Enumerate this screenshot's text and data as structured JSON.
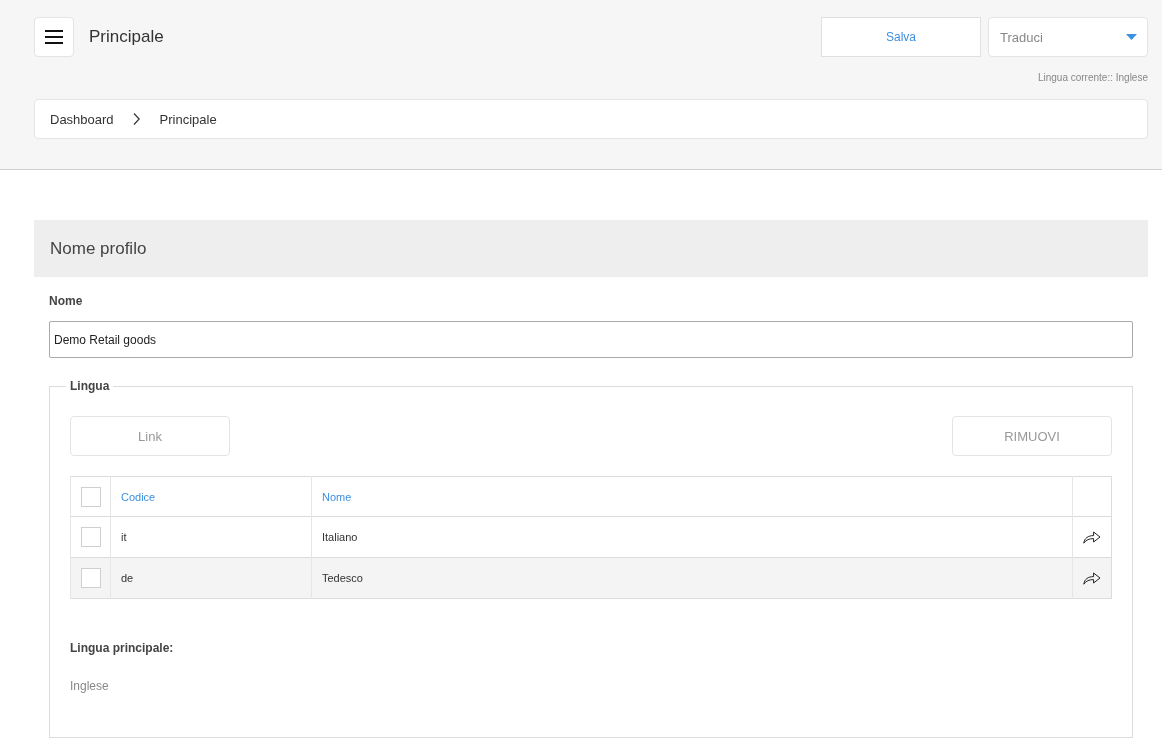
{
  "header": {
    "title": "Principale",
    "save_button": "Salva",
    "translate_select": {
      "value": "Traduci"
    },
    "current_language": "Lingua corrente:: Inglese"
  },
  "breadcrumb": [
    {
      "label": "Dashboard"
    },
    {
      "label": "Principale"
    }
  ],
  "section": {
    "title": "Nome profilo"
  },
  "name_field": {
    "label": "Nome",
    "value": "Demo Retail goods"
  },
  "language_group": {
    "legend": "Lingua",
    "buttons": [
      {
        "label": "Link",
        "disabled": true
      },
      {
        "label": "RIMUOVI",
        "disabled": true
      }
    ],
    "table": {
      "select_all_checked": false,
      "columns": [
        "Codice",
        "Nome"
      ],
      "rows": [
        {
          "code": "it",
          "name": "Italiano",
          "checked": false
        },
        {
          "code": "de",
          "name": "Tedesco",
          "checked": false
        }
      ]
    },
    "main_language": {
      "label": "Lingua principale:",
      "value": "Inglese"
    }
  }
}
